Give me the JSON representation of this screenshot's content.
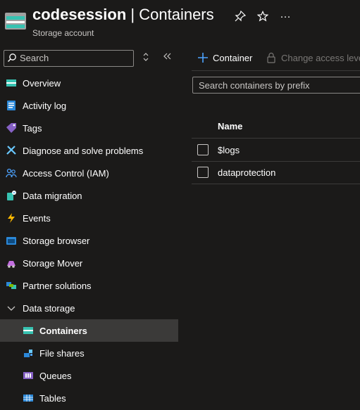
{
  "header": {
    "resource_name": "codesession",
    "separator": " | ",
    "page": "Containers",
    "subtitle": "Storage account",
    "pin_icon": "pin-icon",
    "star_icon": "star-icon",
    "more_icon": "ellipsis-icon",
    "more_glyph": "···"
  },
  "sidebar": {
    "search": {
      "placeholder": "Search",
      "value": ""
    },
    "collapse_icon": "double-chevron-left-icon",
    "items": [
      {
        "label": "Overview",
        "icon": "overview-icon"
      },
      {
        "label": "Activity log",
        "icon": "activity-log-icon"
      },
      {
        "label": "Tags",
        "icon": "tag-icon"
      },
      {
        "label": "Diagnose and solve problems",
        "icon": "wrench-icon"
      },
      {
        "label": "Access Control (IAM)",
        "icon": "people-icon"
      },
      {
        "label": "Data migration",
        "icon": "data-migration-icon"
      },
      {
        "label": "Events",
        "icon": "lightning-icon"
      },
      {
        "label": "Storage browser",
        "icon": "storage-browser-icon"
      },
      {
        "label": "Storage Mover",
        "icon": "storage-mover-icon"
      },
      {
        "label": "Partner solutions",
        "icon": "partner-icon"
      },
      {
        "label": "Data storage",
        "icon": "chevron-down-icon"
      },
      {
        "label": "Containers",
        "icon": "containers-icon",
        "selected": true
      },
      {
        "label": "File shares",
        "icon": "file-shares-icon"
      },
      {
        "label": "Queues",
        "icon": "queues-icon"
      },
      {
        "label": "Tables",
        "icon": "tables-icon"
      }
    ]
  },
  "toolbar": {
    "add_container": "Container",
    "change_access": "Change access leve"
  },
  "filter": {
    "placeholder": "Search containers by prefix",
    "value": ""
  },
  "table": {
    "columns": [
      "Name"
    ],
    "rows": [
      {
        "name": "$logs"
      },
      {
        "name": "dataprotection"
      }
    ]
  },
  "colors": {
    "background": "#1b1a19",
    "selected": "#3b3a39",
    "accent": "#0078d4"
  }
}
